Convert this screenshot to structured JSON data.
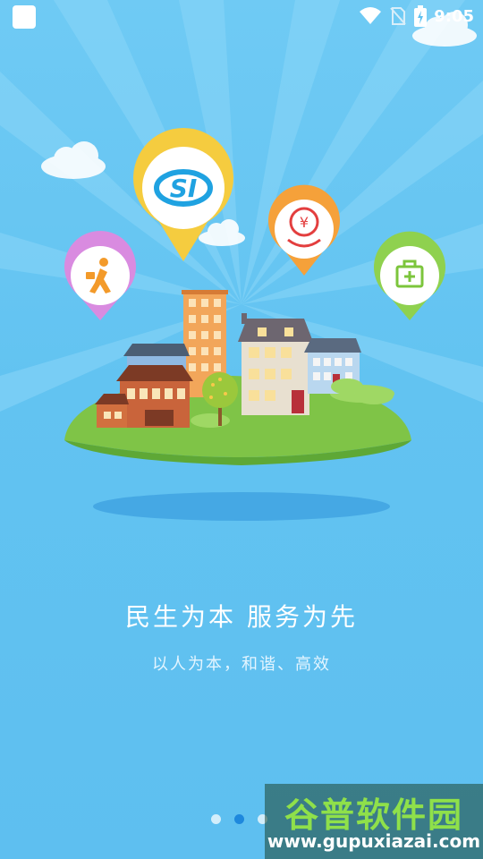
{
  "status_bar": {
    "time": "9:05",
    "icons": [
      "app-notification-icon",
      "wifi-icon",
      "no-sim-icon",
      "battery-charging-icon"
    ]
  },
  "illustration": {
    "pins": [
      {
        "name": "social-security-icon",
        "text": "SI",
        "color": "#f5cc3f"
      },
      {
        "name": "yuan-finance-icon",
        "text": "¥",
        "color": "#f5a13a"
      },
      {
        "name": "employment-icon",
        "color": "#d98be0"
      },
      {
        "name": "medical-kit-icon",
        "color": "#8fd14f"
      }
    ]
  },
  "content": {
    "title": "民生为本  服务为先",
    "subtitle": "以人为本，和谐、高效"
  },
  "pager": {
    "count": 3,
    "active_index": 1
  },
  "watermark": {
    "main": "谷普软件园",
    "url": "www.gupuxiazai.com"
  }
}
